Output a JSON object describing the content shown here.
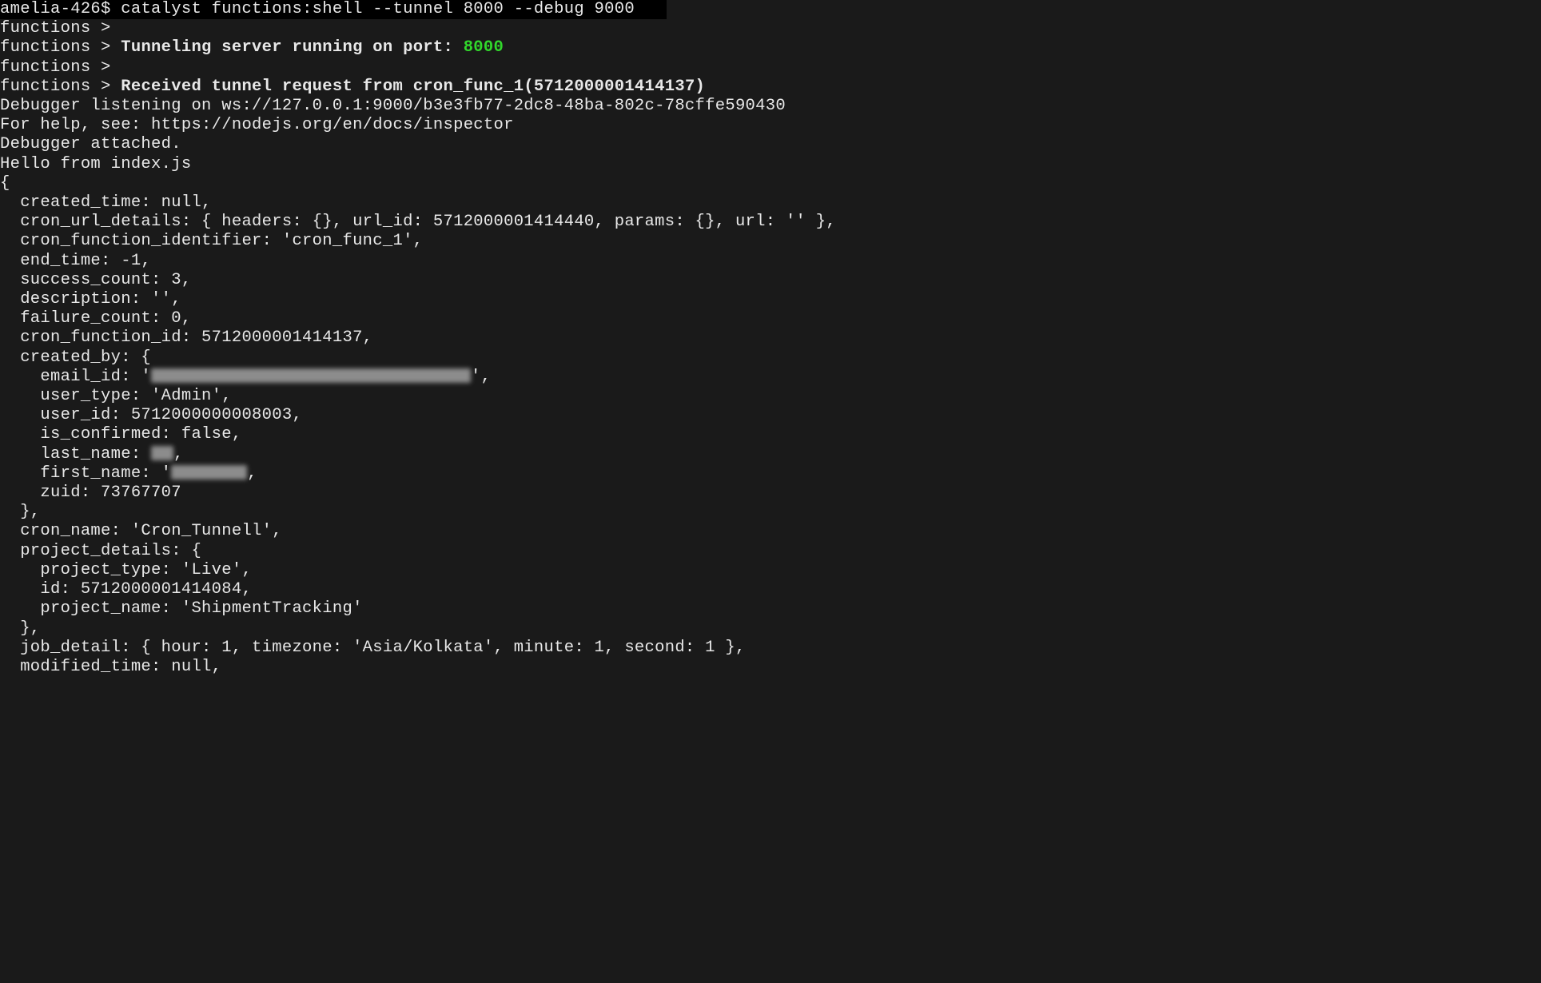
{
  "prompt": {
    "user_host": "amelia-426$",
    "command": "catalyst functions:shell --tunnel 8000 --debug 9000"
  },
  "lines": {
    "l1": "functions >",
    "l2_prefix": "functions > ",
    "l2_bold": "Tunneling server running on port: ",
    "l2_port": "8000",
    "l3": "functions >",
    "l4_prefix": "functions > ",
    "l4_bold": "Received tunnel request from cron_func_1(5712000001414137)",
    "l5": "Debugger listening on ws://127.0.0.1:9000/b3e3fb77-2dc8-48ba-802c-78cffe590430",
    "l6": "For help, see: https://nodejs.org/en/docs/inspector",
    "l7": "Debugger attached.",
    "l8": "Hello from index.js",
    "l9": "",
    "obj_open": "{",
    "created_time": "  created_time: null,",
    "cron_url": "  cron_url_details: { headers: {}, url_id: 5712000001414440, params: {}, url: '' },",
    "cron_fn_id_str": "  cron_function_identifier: 'cron_func_1',",
    "end_time": "  end_time: -1,",
    "success_count": "  success_count: 3,",
    "description": "  description: '',",
    "failure_count": "  failure_count: 0,",
    "cron_fn_id": "  cron_function_id: 5712000001414137,",
    "created_by_open": "  created_by: {",
    "email_prefix": "    email_id: '",
    "email_suffix": "',",
    "user_type": "    user_type: 'Admin',",
    "user_id": "    user_id: 5712000000008003,",
    "is_confirmed": "    is_confirmed: false,",
    "last_name_prefix": "    last_name: ",
    "last_name_suffix": ",",
    "first_name_prefix": "    first_name: '",
    "first_name_suffix": ",",
    "zuid": "    zuid: 73767707",
    "created_by_close": "  },",
    "cron_name": "  cron_name: 'Cron_Tunnell',",
    "project_open": "  project_details: {",
    "project_type": "    project_type: 'Live',",
    "project_id": "    id: 5712000001414084,",
    "project_name": "    project_name: 'ShipmentTracking'",
    "project_close": "  },",
    "job_detail": "  job_detail: { hour: 1, timezone: 'Asia/Kolkata', minute: 1, second: 1 },",
    "modified_time": "  modified_time: null,"
  }
}
